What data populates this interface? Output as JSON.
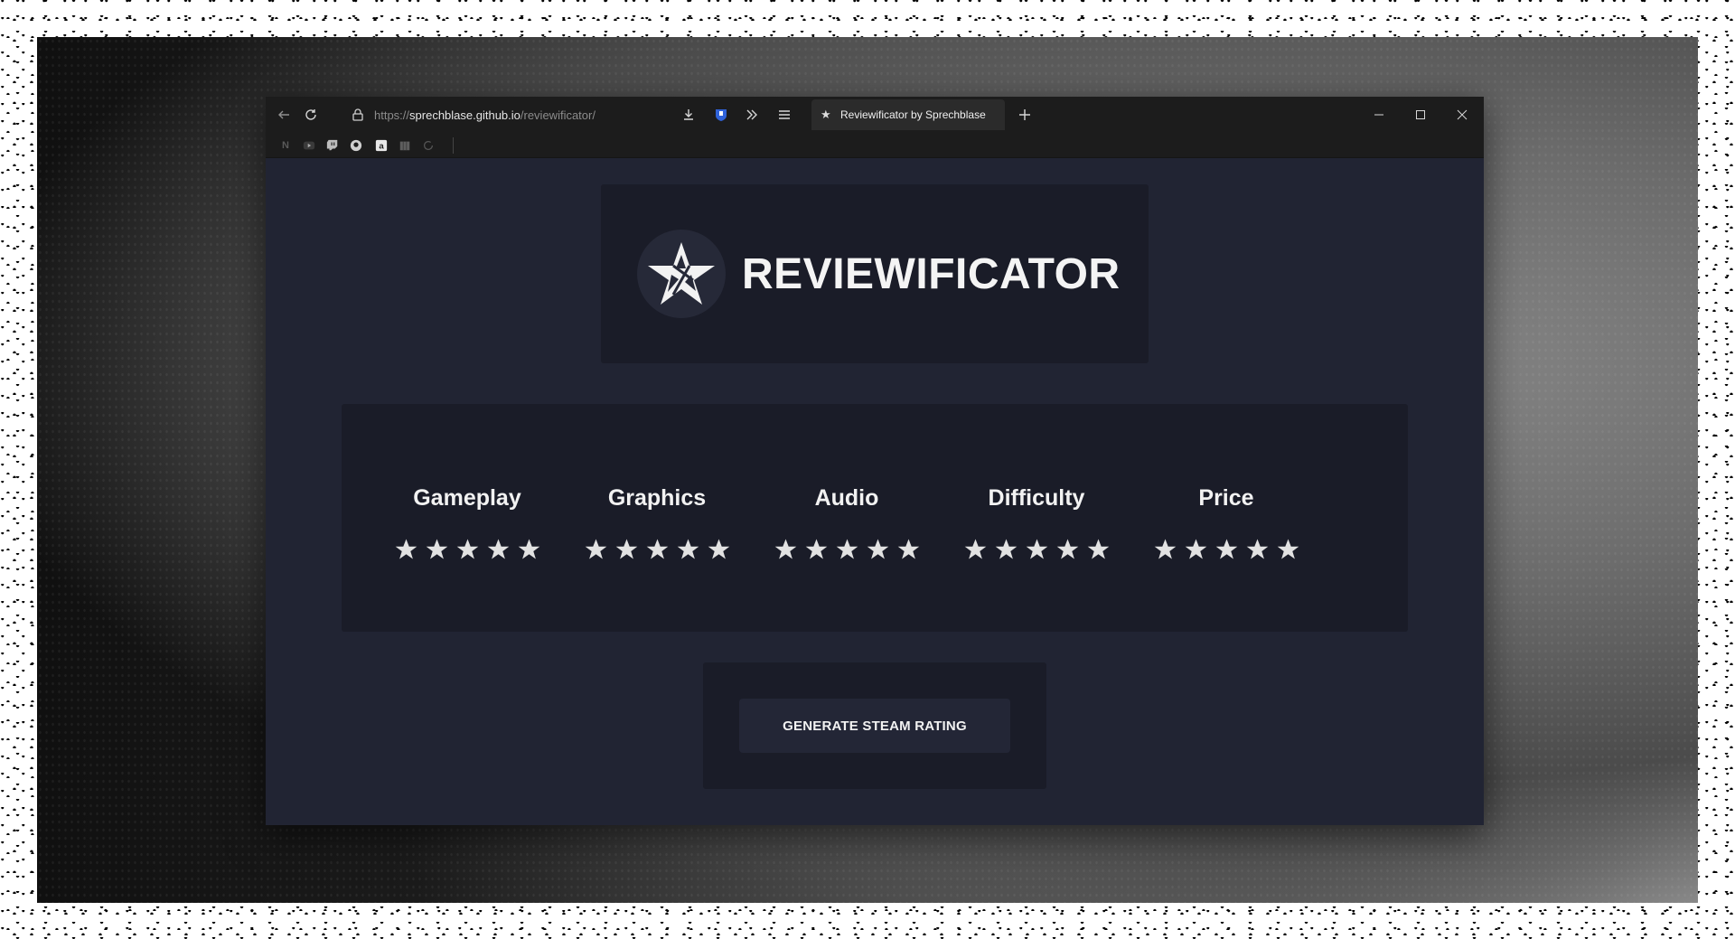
{
  "browser": {
    "url_scheme": "https://",
    "url_host": "sprechblase.github.io",
    "url_path": "/reviewificator/",
    "tab_title": "Reviewificator by Sprechblase",
    "icons": {
      "back": "arrow-left-icon",
      "reload": "reload-icon",
      "lock": "lock-icon",
      "downloads": "download-icon",
      "extension": "shield-extension-icon",
      "overflow": "chevron-double-right-icon",
      "menu": "hamburger-menu-icon",
      "new_tab": "plus-icon",
      "minimize": "minimize-icon",
      "maximize": "maximize-icon",
      "close": "close-icon"
    },
    "bookmarks": [
      {
        "name": "netflix-bookmark",
        "icon": "netflix-icon"
      },
      {
        "name": "youtube-bookmark",
        "icon": "youtube-icon"
      },
      {
        "name": "twitch-bookmark",
        "icon": "twitch-icon"
      },
      {
        "name": "github-bookmark",
        "icon": "github-icon"
      },
      {
        "name": "amazon-bookmark",
        "icon": "amazon-icon"
      },
      {
        "name": "folder-bookmark",
        "icon": "folder-icon"
      },
      {
        "name": "sync-bookmark",
        "icon": "sync-icon"
      }
    ]
  },
  "app": {
    "title": "REVIEWIFICATOR",
    "logo_icon": "star-logo-icon",
    "categories": [
      {
        "label": "Gameplay",
        "stars": 5,
        "rating": 0
      },
      {
        "label": "Graphics",
        "stars": 5,
        "rating": 0
      },
      {
        "label": "Audio",
        "stars": 5,
        "rating": 0
      },
      {
        "label": "Difficulty",
        "stars": 5,
        "rating": 0
      },
      {
        "label": "Price",
        "stars": 5,
        "rating": 0
      }
    ],
    "generate_label": "GENERATE STEAM RATING"
  },
  "colors": {
    "page_bg": "#212433",
    "panel_bg": "#1a1c28",
    "button_bg": "#232636",
    "star_fill": "#e2e2e2",
    "text": "#f2f2f2"
  }
}
